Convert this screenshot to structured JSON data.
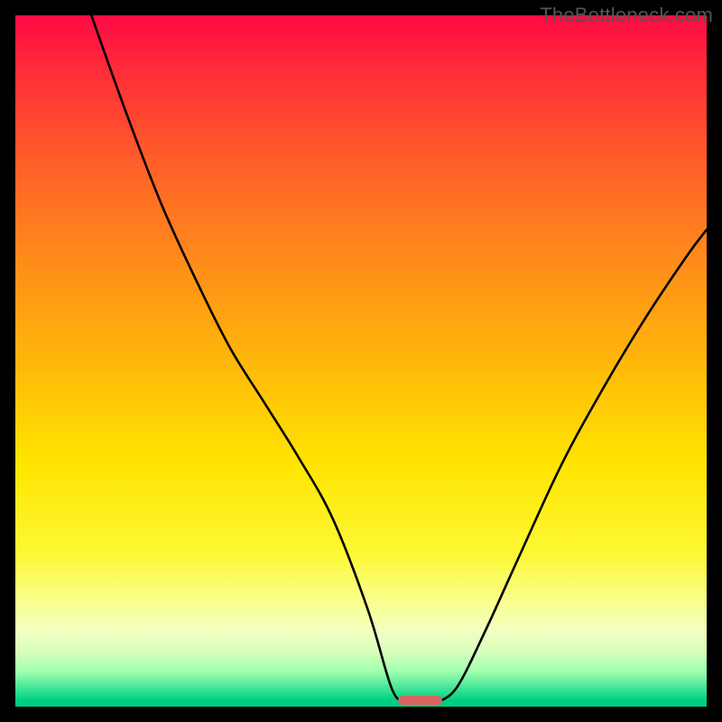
{
  "watermark": "TheBottleneck.com",
  "colors": {
    "frame": "#000000",
    "curve": "#000000",
    "marker": "#d9645e",
    "watermark": "#555555"
  },
  "chart_data": {
    "type": "line",
    "title": "",
    "xlabel": "",
    "ylabel": "",
    "xlim": [
      0,
      100
    ],
    "ylim": [
      0,
      100
    ],
    "grid": false,
    "legend": false,
    "series": [
      {
        "name": "left-branch",
        "x": [
          11,
          16,
          21,
          26,
          31,
          36,
          41,
          46,
          51,
          54.5,
          56.5
        ],
        "y": [
          100,
          86,
          73,
          62,
          52,
          44,
          36,
          27,
          14,
          2.5,
          0.8
        ]
      },
      {
        "name": "right-branch",
        "x": [
          61.5,
          64,
          68,
          73,
          79,
          85,
          91,
          97,
          100
        ],
        "y": [
          0.8,
          3,
          11,
          22,
          35,
          46,
          56,
          65,
          69
        ]
      }
    ],
    "marker": {
      "x_center": 58.5,
      "y": 0.9,
      "width_pct": 6.4,
      "height_pct": 1.4
    },
    "notes": "V-shaped bottleneck curve over vertical heatmap gradient; values are relative (0–100) estimates read from axis-less figure. y measured from bottom (0) to top (100)."
  }
}
